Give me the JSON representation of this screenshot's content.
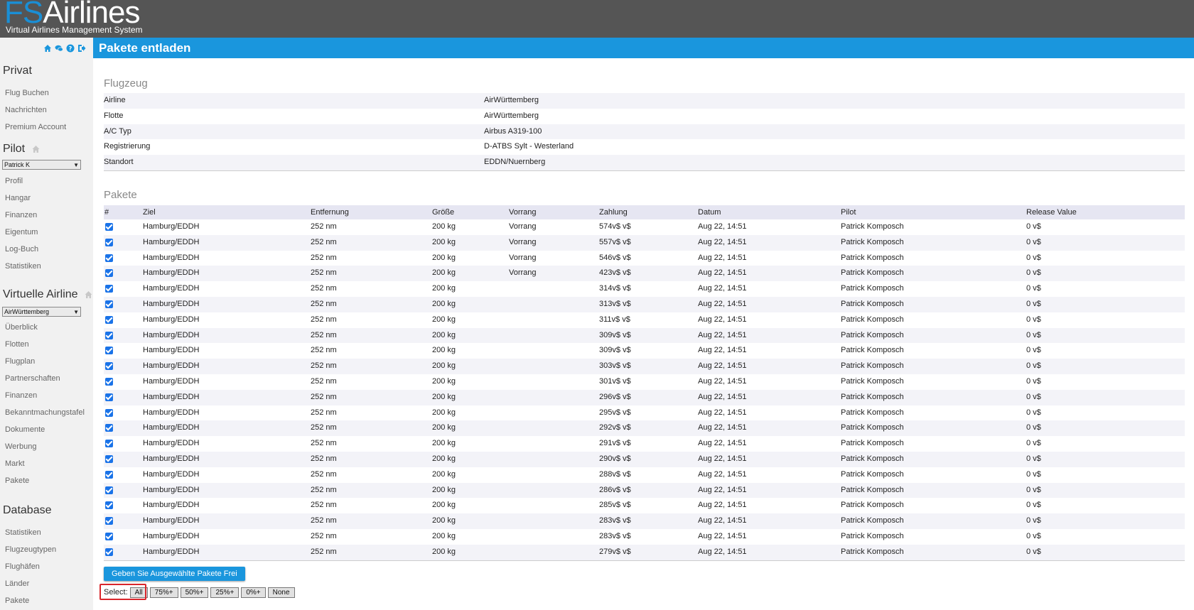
{
  "header": {
    "logo_fs": "FS",
    "logo_air": "Airlines",
    "logo_sub": "Virtual Airlines Management System"
  },
  "sidebar": {
    "icons": [
      "home-icon",
      "chat-icon",
      "help-icon",
      "logout-icon"
    ],
    "privat": {
      "title": "Privat",
      "items": [
        "Flug Buchen",
        "Nachrichten",
        "Premium Account"
      ]
    },
    "pilot": {
      "title": "Pilot",
      "selected": "Patrick K",
      "items": [
        "Profil",
        "Hangar",
        "Finanzen",
        "Eigentum",
        "Log-Buch",
        "Statistiken"
      ]
    },
    "airline": {
      "title": "Virtuelle Airline",
      "selected": "AirWürttemberg",
      "items": [
        "Überblick",
        "Flotten",
        "Flugplan",
        "Partnerschaften",
        "Finanzen",
        "Bekanntmachungstafel",
        "Dokumente",
        "Werbung",
        "Markt",
        "Pakete"
      ]
    },
    "database": {
      "title": "Database",
      "items": [
        "Statistiken",
        "Flugzeugtypen",
        "Flughäfen",
        "Länder",
        "Pakete"
      ]
    }
  },
  "page": {
    "title": "Pakete entladen"
  },
  "aircraft": {
    "title": "Flugzeug",
    "rows": [
      {
        "label": "Airline",
        "value": "AirWürttemberg"
      },
      {
        "label": "Flotte",
        "value": "AirWürttemberg"
      },
      {
        "label": "A/C Typ",
        "value": "Airbus A319-100"
      },
      {
        "label": "Registrierung",
        "value": "D-ATBS Sylt - Westerland"
      },
      {
        "label": "Standort",
        "value": "EDDN/Nuernberg"
      }
    ]
  },
  "packages": {
    "title": "Pakete",
    "columns": [
      "#",
      "Ziel",
      "Entfernung",
      "Größe",
      "Vorrang",
      "Zahlung",
      "Datum",
      "Pilot",
      "Release Value"
    ],
    "rows": [
      {
        "ziel": "Hamburg/EDDH",
        "entfernung": "252 nm",
        "groesse": "200 kg",
        "vorrang": "Vorrang",
        "zahlung": "574v$ v$",
        "datum": "Aug 22, 14:51",
        "pilot": "Patrick Komposch",
        "release": "0 v$"
      },
      {
        "ziel": "Hamburg/EDDH",
        "entfernung": "252 nm",
        "groesse": "200 kg",
        "vorrang": "Vorrang",
        "zahlung": "557v$ v$",
        "datum": "Aug 22, 14:51",
        "pilot": "Patrick Komposch",
        "release": "0 v$"
      },
      {
        "ziel": "Hamburg/EDDH",
        "entfernung": "252 nm",
        "groesse": "200 kg",
        "vorrang": "Vorrang",
        "zahlung": "546v$ v$",
        "datum": "Aug 22, 14:51",
        "pilot": "Patrick Komposch",
        "release": "0 v$"
      },
      {
        "ziel": "Hamburg/EDDH",
        "entfernung": "252 nm",
        "groesse": "200 kg",
        "vorrang": "Vorrang",
        "zahlung": "423v$ v$",
        "datum": "Aug 22, 14:51",
        "pilot": "Patrick Komposch",
        "release": "0 v$"
      },
      {
        "ziel": "Hamburg/EDDH",
        "entfernung": "252 nm",
        "groesse": "200 kg",
        "vorrang": "",
        "zahlung": "314v$ v$",
        "datum": "Aug 22, 14:51",
        "pilot": "Patrick Komposch",
        "release": "0 v$"
      },
      {
        "ziel": "Hamburg/EDDH",
        "entfernung": "252 nm",
        "groesse": "200 kg",
        "vorrang": "",
        "zahlung": "313v$ v$",
        "datum": "Aug 22, 14:51",
        "pilot": "Patrick Komposch",
        "release": "0 v$"
      },
      {
        "ziel": "Hamburg/EDDH",
        "entfernung": "252 nm",
        "groesse": "200 kg",
        "vorrang": "",
        "zahlung": "311v$ v$",
        "datum": "Aug 22, 14:51",
        "pilot": "Patrick Komposch",
        "release": "0 v$"
      },
      {
        "ziel": "Hamburg/EDDH",
        "entfernung": "252 nm",
        "groesse": "200 kg",
        "vorrang": "",
        "zahlung": "309v$ v$",
        "datum": "Aug 22, 14:51",
        "pilot": "Patrick Komposch",
        "release": "0 v$"
      },
      {
        "ziel": "Hamburg/EDDH",
        "entfernung": "252 nm",
        "groesse": "200 kg",
        "vorrang": "",
        "zahlung": "309v$ v$",
        "datum": "Aug 22, 14:51",
        "pilot": "Patrick Komposch",
        "release": "0 v$"
      },
      {
        "ziel": "Hamburg/EDDH",
        "entfernung": "252 nm",
        "groesse": "200 kg",
        "vorrang": "",
        "zahlung": "303v$ v$",
        "datum": "Aug 22, 14:51",
        "pilot": "Patrick Komposch",
        "release": "0 v$"
      },
      {
        "ziel": "Hamburg/EDDH",
        "entfernung": "252 nm",
        "groesse": "200 kg",
        "vorrang": "",
        "zahlung": "301v$ v$",
        "datum": "Aug 22, 14:51",
        "pilot": "Patrick Komposch",
        "release": "0 v$"
      },
      {
        "ziel": "Hamburg/EDDH",
        "entfernung": "252 nm",
        "groesse": "200 kg",
        "vorrang": "",
        "zahlung": "296v$ v$",
        "datum": "Aug 22, 14:51",
        "pilot": "Patrick Komposch",
        "release": "0 v$"
      },
      {
        "ziel": "Hamburg/EDDH",
        "entfernung": "252 nm",
        "groesse": "200 kg",
        "vorrang": "",
        "zahlung": "295v$ v$",
        "datum": "Aug 22, 14:51",
        "pilot": "Patrick Komposch",
        "release": "0 v$"
      },
      {
        "ziel": "Hamburg/EDDH",
        "entfernung": "252 nm",
        "groesse": "200 kg",
        "vorrang": "",
        "zahlung": "292v$ v$",
        "datum": "Aug 22, 14:51",
        "pilot": "Patrick Komposch",
        "release": "0 v$"
      },
      {
        "ziel": "Hamburg/EDDH",
        "entfernung": "252 nm",
        "groesse": "200 kg",
        "vorrang": "",
        "zahlung": "291v$ v$",
        "datum": "Aug 22, 14:51",
        "pilot": "Patrick Komposch",
        "release": "0 v$"
      },
      {
        "ziel": "Hamburg/EDDH",
        "entfernung": "252 nm",
        "groesse": "200 kg",
        "vorrang": "",
        "zahlung": "290v$ v$",
        "datum": "Aug 22, 14:51",
        "pilot": "Patrick Komposch",
        "release": "0 v$"
      },
      {
        "ziel": "Hamburg/EDDH",
        "entfernung": "252 nm",
        "groesse": "200 kg",
        "vorrang": "",
        "zahlung": "288v$ v$",
        "datum": "Aug 22, 14:51",
        "pilot": "Patrick Komposch",
        "release": "0 v$"
      },
      {
        "ziel": "Hamburg/EDDH",
        "entfernung": "252 nm",
        "groesse": "200 kg",
        "vorrang": "",
        "zahlung": "286v$ v$",
        "datum": "Aug 22, 14:51",
        "pilot": "Patrick Komposch",
        "release": "0 v$"
      },
      {
        "ziel": "Hamburg/EDDH",
        "entfernung": "252 nm",
        "groesse": "200 kg",
        "vorrang": "",
        "zahlung": "285v$ v$",
        "datum": "Aug 22, 14:51",
        "pilot": "Patrick Komposch",
        "release": "0 v$"
      },
      {
        "ziel": "Hamburg/EDDH",
        "entfernung": "252 nm",
        "groesse": "200 kg",
        "vorrang": "",
        "zahlung": "283v$ v$",
        "datum": "Aug 22, 14:51",
        "pilot": "Patrick Komposch",
        "release": "0 v$"
      },
      {
        "ziel": "Hamburg/EDDH",
        "entfernung": "252 nm",
        "groesse": "200 kg",
        "vorrang": "",
        "zahlung": "283v$ v$",
        "datum": "Aug 22, 14:51",
        "pilot": "Patrick Komposch",
        "release": "0 v$"
      },
      {
        "ziel": "Hamburg/EDDH",
        "entfernung": "252 nm",
        "groesse": "200 kg",
        "vorrang": "",
        "zahlung": "279v$ v$",
        "datum": "Aug 22, 14:51",
        "pilot": "Patrick Komposch",
        "release": "0 v$"
      }
    ],
    "release_button": "Geben Sie Ausgewählte Pakete Frei",
    "select_label": "Select:",
    "select_options": [
      "All",
      "75%+",
      "50%+",
      "25%+",
      "0%+",
      "None"
    ]
  },
  "colors": {
    "header_bg": "#555555",
    "accent": "#1a96dd",
    "sidebar_bg": "#f1f1f1",
    "highlight": "#d9262b"
  }
}
